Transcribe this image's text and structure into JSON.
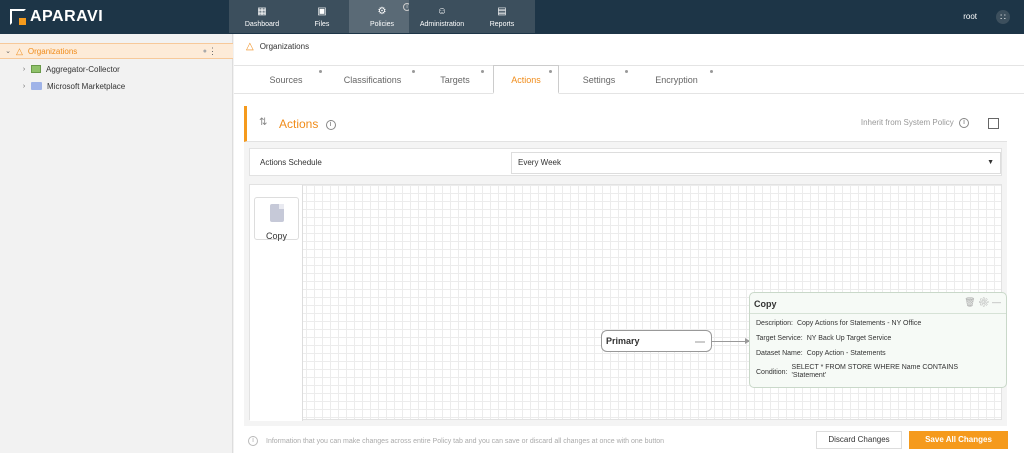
{
  "app": {
    "logo_text": "APARAVI",
    "user": "root"
  },
  "nav": [
    {
      "label": "Dashboard",
      "icon": "dashboard-icon"
    },
    {
      "label": "Files",
      "icon": "folder-icon"
    },
    {
      "label": "Policies",
      "icon": "gear-icon",
      "active": true
    },
    {
      "label": "Administration",
      "icon": "users-icon"
    },
    {
      "label": "Reports",
      "icon": "report-icon"
    }
  ],
  "sidebar": {
    "items": [
      {
        "label": "Organizations",
        "selected": true
      },
      {
        "label": "Aggregator-Collector"
      },
      {
        "label": "Microsoft Marketplace"
      }
    ]
  },
  "breadcrumb": {
    "label": "Organizations"
  },
  "tabs": [
    "Sources",
    "Classifications",
    "Targets",
    "Actions",
    "Settings",
    "Encryption"
  ],
  "active_tab": "Actions",
  "panel": {
    "title": "Actions",
    "inherit_label": "Inherit from System Policy",
    "schedule_label": "Actions Schedule",
    "schedule_value": "Every Week"
  },
  "palette": {
    "copy_label": "Copy"
  },
  "flow": {
    "primary_label": "Primary",
    "copy_node": {
      "title": "Copy",
      "description_key": "Description:",
      "description_val": "Copy Actions for Statements - NY Office",
      "target_key": "Target Service:",
      "target_val": "NY Back Up Target Service",
      "dataset_key": "Dataset Name:",
      "dataset_val": "Copy Action - Statements",
      "condition_key": "Condition:",
      "condition_val": "SELECT * FROM STORE WHERE Name CONTAINS 'Statement'"
    }
  },
  "footer": {
    "note": "Information that you can make changes across entire Policy tab and you can save or discard all changes at once with one button",
    "discard_label": "Discard Changes",
    "save_label": "Save All Changes"
  },
  "colors": {
    "accent": "#f59a1c",
    "topbar": "#1d3547"
  }
}
